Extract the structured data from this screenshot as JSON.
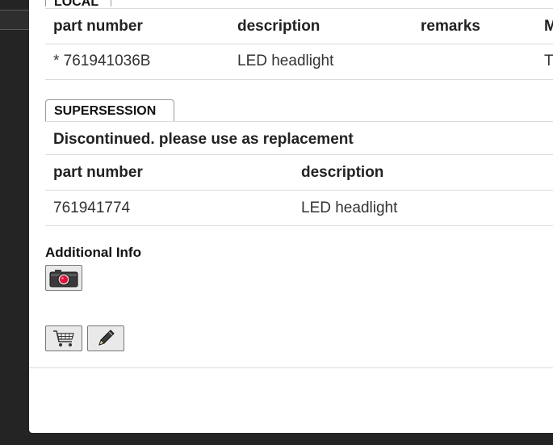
{
  "local": {
    "tab_label": "LOCAL",
    "headers": [
      "part number",
      "description",
      "remarks",
      "M"
    ],
    "rows": [
      {
        "part_number": "* 761941036B",
        "description": "LED headlight",
        "remarks": "",
        "m": "T"
      }
    ]
  },
  "supersession": {
    "tab_label": "SUPERSESSION",
    "message": "Discontinued. please use as replacement",
    "headers": [
      "part number",
      "description"
    ],
    "rows": [
      {
        "part_number": "761941774",
        "description": "LED headlight"
      }
    ]
  },
  "additional_info": {
    "label": "Additional Info",
    "icon": "camera-icon"
  },
  "actions": {
    "cart_icon": "cart-icon",
    "edit_icon": "pencil-icon"
  }
}
